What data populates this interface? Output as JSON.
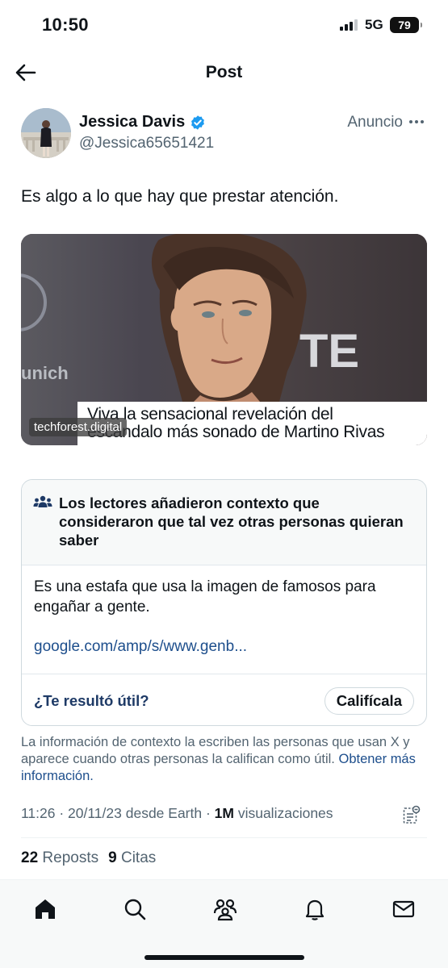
{
  "status_bar": {
    "time": "10:50",
    "network": "5G",
    "battery": "79"
  },
  "nav": {
    "title": "Post",
    "back_icon": "arrow-left-icon"
  },
  "post": {
    "author_name": "Jessica Davis",
    "author_handle": "@Jessica65651421",
    "verified_badge_color": "#1d9bf0",
    "ad_label": "Anuncio",
    "text": "Es algo a lo que hay que prestar atención.",
    "media": {
      "caption_line1": "Viva la sensacional revelación del",
      "caption_line2": "escándalo más sonado de Martino Rivas",
      "watermark": "techforest.digital"
    },
    "timestamp": "11:26 · 20/11/23 desde Earth · ",
    "views_count": "1M",
    "views_label": " visualizaciones",
    "reposts_count": "22",
    "reposts_label": "Reposts",
    "quotes_count": "9",
    "quotes_label": "Citas"
  },
  "community_note": {
    "title": "Los lectores añadieron contexto que consideraron que tal vez otras personas quieran saber",
    "body": "Es una estafa que usa la imagen de famosos para engañar a gente.",
    "link": "google.com/amp/s/www.genb...",
    "helpful_question": "¿Te resultó útil?",
    "rate_button": "Califícala",
    "disclaimer": "La información de contexto la escriben las personas que usan X y aparece cuando otras personas la califican como útil. ",
    "more_info_link": "Obtener más información."
  },
  "tab_bar": {
    "items": [
      "home-icon",
      "search-icon",
      "communities-icon",
      "notifications-icon",
      "messages-icon"
    ]
  },
  "colors": {
    "text": "#0f1419",
    "secondary": "#536471",
    "link": "#1d4e8c",
    "accent": "#1d9bf0"
  }
}
